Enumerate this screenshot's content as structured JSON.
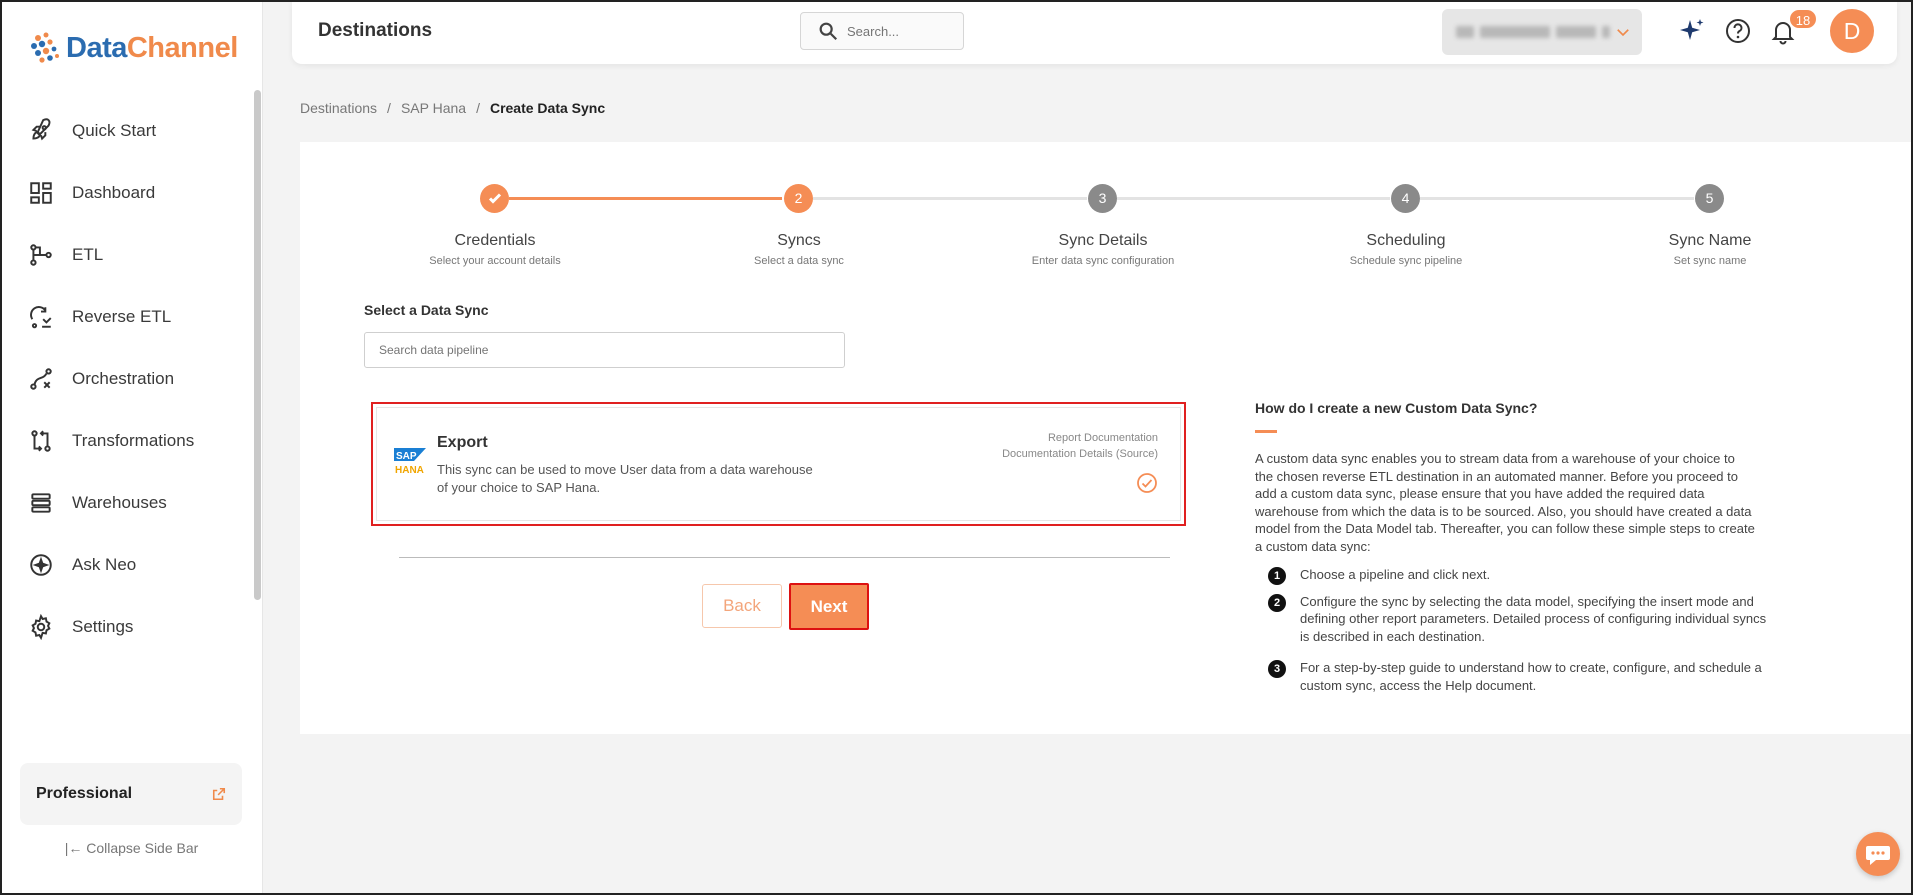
{
  "brand": {
    "name_part1": "Data",
    "name_part2": "Channel"
  },
  "sidebar": {
    "items": [
      {
        "label": "Quick Start",
        "icon": "rocket-icon"
      },
      {
        "label": "Dashboard",
        "icon": "dashboard-icon"
      },
      {
        "label": "ETL",
        "icon": "etl-icon"
      },
      {
        "label": "Reverse ETL",
        "icon": "reverse-etl-icon"
      },
      {
        "label": "Orchestration",
        "icon": "orchestration-icon"
      },
      {
        "label": "Transformations",
        "icon": "transformations-icon"
      },
      {
        "label": "Warehouses",
        "icon": "warehouses-icon"
      },
      {
        "label": "Ask Neo",
        "icon": "ask-neo-icon"
      },
      {
        "label": "Settings",
        "icon": "gear-icon"
      }
    ],
    "plan": "Professional",
    "collapse_label": "Collapse Side Bar"
  },
  "header": {
    "title": "Destinations",
    "search_placeholder": "Search...",
    "notification_count": "18",
    "avatar_letter": "D"
  },
  "breadcrumb": {
    "items": [
      "Destinations",
      "SAP Hana"
    ],
    "current": "Create Data Sync"
  },
  "stepper": {
    "steps": [
      {
        "title": "Credentials",
        "subtitle": "Select your account details",
        "state": "done",
        "num": "1"
      },
      {
        "title": "Syncs",
        "subtitle": "Select a data sync",
        "state": "active",
        "num": "2"
      },
      {
        "title": "Sync Details",
        "subtitle": "Enter data sync configuration",
        "state": "pending",
        "num": "3"
      },
      {
        "title": "Scheduling",
        "subtitle": "Schedule sync pipeline",
        "state": "pending",
        "num": "4"
      },
      {
        "title": "Sync Name",
        "subtitle": "Set sync name",
        "state": "pending",
        "num": "5"
      }
    ]
  },
  "sync_select": {
    "label": "Select a Data Sync",
    "search_placeholder": "Search data pipeline",
    "card": {
      "logo_text_top": "SAP",
      "logo_text_bottom": "HANA",
      "title": "Export",
      "description": "This sync can be used to move User data from a data warehouse of your choice to SAP Hana.",
      "link_report": "Report Documentation",
      "link_details": "Documentation Details (Source)"
    }
  },
  "buttons": {
    "back": "Back",
    "next": "Next"
  },
  "help": {
    "title": "How do I create a new Custom Data Sync?",
    "body": "A custom data sync enables you to stream data from a warehouse of your choice to the chosen reverse ETL destination in an automated manner. Before you proceed to add a custom data sync, please ensure that you have added the required data warehouse from which the data is to be sourced. Also, you should have created a data model from the Data Model tab. Thereafter, you can follow these simple steps to create a custom data sync:",
    "steps": [
      {
        "num": "1",
        "text": "Choose a pipeline and click next."
      },
      {
        "num": "2",
        "text": "Configure the sync by selecting the data model, specifying the insert mode and defining other report parameters. Detailed process of configuring individual syncs is described in each destination."
      },
      {
        "num": "3",
        "text": "For a step-by-step guide to understand how to create, configure, and schedule a custom sync, access the Help document."
      }
    ]
  },
  "colors": {
    "accent": "#f58d55",
    "brand_blue": "#2b6cb0",
    "pending_step": "#8a8a8a",
    "highlight_border": "#e02020"
  }
}
